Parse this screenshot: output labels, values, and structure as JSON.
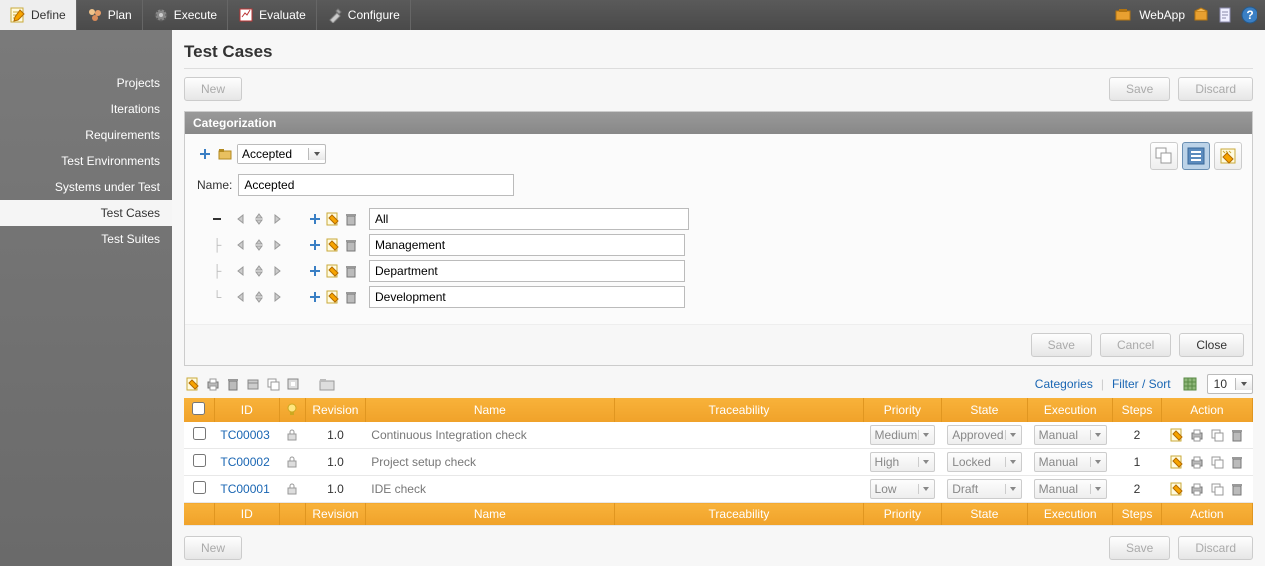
{
  "topnav": {
    "tabs": [
      "Define",
      "Plan",
      "Execute",
      "Evaluate",
      "Configure"
    ],
    "webapp": "WebApp"
  },
  "sidebar": {
    "items": [
      "Projects",
      "Iterations",
      "Requirements",
      "Test Environments",
      "Systems under Test",
      "Test Cases",
      "Test Suites"
    ],
    "active_index": 5
  },
  "page": {
    "title": "Test Cases",
    "new_btn": "New",
    "save_btn": "Save",
    "discard_btn": "Discard"
  },
  "categorization": {
    "header": "Categorization",
    "selected": "Accepted",
    "name_label": "Name:",
    "name_value": "Accepted",
    "tree": [
      "All",
      "Management",
      "Department",
      "Development"
    ],
    "save": "Save",
    "cancel": "Cancel",
    "close": "Close"
  },
  "toolbar": {
    "categories": "Categories",
    "filter_sort": "Filter / Sort",
    "page_size": "10"
  },
  "table": {
    "headers": {
      "id": "ID",
      "revision": "Revision",
      "name": "Name",
      "traceability": "Traceability",
      "priority": "Priority",
      "state": "State",
      "execution": "Execution",
      "steps": "Steps",
      "action": "Action"
    },
    "rows": [
      {
        "id": "TC00003",
        "revision": "1.0",
        "name": "Continuous Integration check",
        "traceability": "",
        "priority": "Medium",
        "state": "Approved",
        "execution": "Manual",
        "steps": "2"
      },
      {
        "id": "TC00002",
        "revision": "1.0",
        "name": "Project setup check",
        "traceability": "",
        "priority": "High",
        "state": "Locked",
        "execution": "Manual",
        "steps": "1"
      },
      {
        "id": "TC00001",
        "revision": "1.0",
        "name": "IDE check",
        "traceability": "",
        "priority": "Low",
        "state": "Draft",
        "execution": "Manual",
        "steps": "2"
      }
    ]
  }
}
